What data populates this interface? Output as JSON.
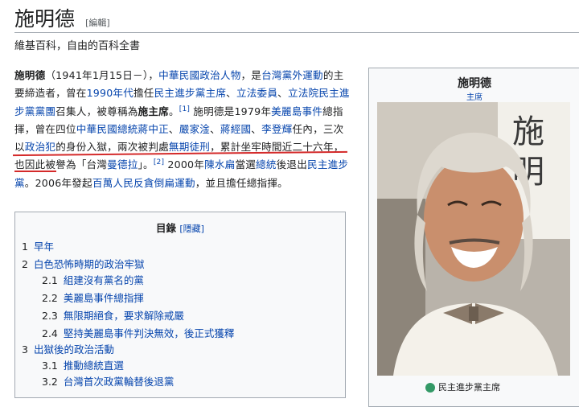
{
  "header": {
    "title": "施明德",
    "edit_label": "[編輯]",
    "tagline": "維基百科，自由的百科全書"
  },
  "lead": {
    "p1_name": "施明德",
    "p1_a": "（1941年1月15日－），",
    "p1_link1": "中華民國政治人物",
    "p1_b": "，是",
    "p1_link2": "台灣黨外運動",
    "p1_c": "的主要締造者，曾在",
    "p1_link3": "1990年代",
    "p1_d": "擔任",
    "p1_link4": "民主進步黨主席",
    "p1_e": "、",
    "p1_link5": "立法委員",
    "p1_f": "、",
    "p1_link6": "立法院民主進步黨黨團",
    "p1_g": "召集人，被尊稱為",
    "p1_bold": "施主席",
    "p1_h": "。",
    "ref1": "[1]",
    "p1_i": " 施明德是1979年",
    "p1_link7": "美麗島事件",
    "p1_j": "總指揮，曾在四位",
    "p1_link8": "中華民國總統",
    "p1_k": "蔣中正",
    "p1_l": "、",
    "p1_link9": "嚴家淦",
    "p1_m": "、",
    "p1_link10": "蔣經國",
    "p1_n": "、",
    "p1_link11": "李登輝",
    "p1_o": "任內，三次以",
    "p1_link12": "政治犯",
    "p1_p": "的身份入獄，兩次被判處",
    "p1_link13": "無期徒刑",
    "p1_q": "，累計坐牢時間近二十六年，也因此被譽為「台灣",
    "p1_link14": "曼德拉",
    "p1_r": "」。",
    "ref2": "[2]",
    "p1_s": " 2000年",
    "p1_link15": "陳水扁",
    "p1_t": "當選",
    "p1_link16": "總統",
    "p1_u": "後退出",
    "p1_link17": "民主進步黨",
    "p1_v": "。2006年發起",
    "p1_link18": "百萬人民反貪倒扁運動",
    "p1_w": "，並且擔任總指揮。"
  },
  "toc": {
    "title": "目錄",
    "toggle": "[隱藏]",
    "items": [
      {
        "num": "1",
        "label": "早年"
      },
      {
        "num": "2",
        "label": "白色恐怖時期的政治牢獄"
      },
      {
        "num": "2.1",
        "label": "組建沒有黨名的黨"
      },
      {
        "num": "2.2",
        "label": "美麗島事件總指揮"
      },
      {
        "num": "2.3",
        "label": "無限期絕食，要求解除戒嚴"
      },
      {
        "num": "2.4",
        "label": "堅持美麗島事件判決無效，後正式獲釋"
      },
      {
        "num": "3",
        "label": "出獄後的政治活動"
      },
      {
        "num": "3.1",
        "label": "推動總統直選"
      },
      {
        "num": "3.2",
        "label": "台灣首次政黨輪替後退黨"
      }
    ]
  },
  "infobox": {
    "name": "施明德",
    "role": "主席",
    "footer": "民主進步黨主席"
  },
  "colors": {
    "link": "#0645ad",
    "redlink": "#ba0000",
    "annotation_underline": "#d42a2a",
    "border": "#a2a9b1"
  }
}
